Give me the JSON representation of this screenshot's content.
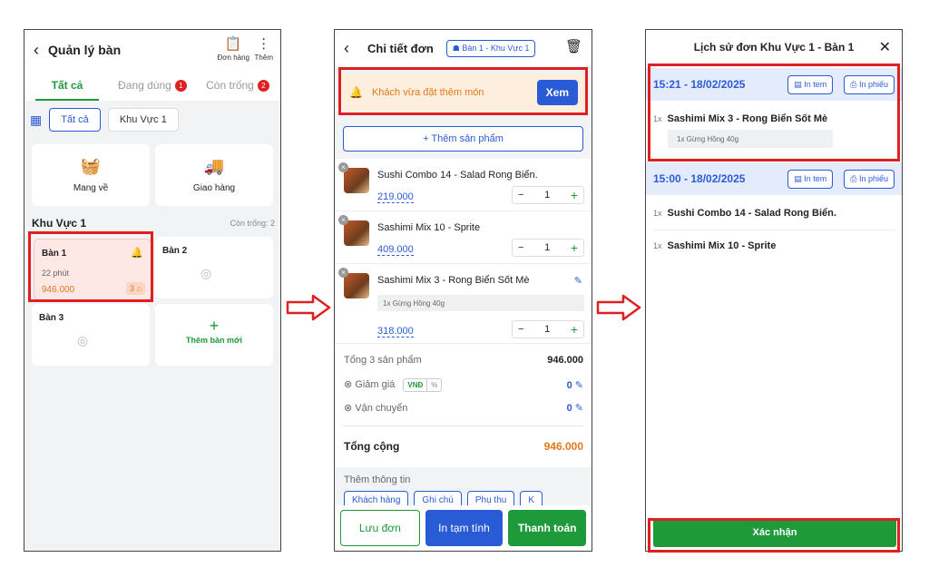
{
  "screen1": {
    "title": "Quản lý bàn",
    "tool_orders": "Đơn hàng",
    "tool_more": "Thêm",
    "tabs": [
      {
        "label": "Tất cả"
      },
      {
        "label": "Đang dùng",
        "badge": "1"
      },
      {
        "label": "Còn trống",
        "badge": "2"
      }
    ],
    "filters": [
      "Tất cả",
      "Khu Vực 1"
    ],
    "services": [
      "Mang về",
      "Giao hàng"
    ],
    "area_name": "Khu Vực 1",
    "area_free": "Còn trống: 2",
    "table1": {
      "name": "Bàn 1",
      "time": "22 phút",
      "amount": "946.000",
      "guests": "3"
    },
    "table2": {
      "name": "Bàn 2"
    },
    "table3": {
      "name": "Bàn 3"
    },
    "add_table": "Thêm bàn mới"
  },
  "screen2": {
    "title": "Chi tiết đơn",
    "table_pill": "Bàn 1 - Khu Vực 1",
    "notice_text": "Khách vừa đặt thêm món",
    "notice_button": "Xem",
    "add_product": "+ Thêm sản phẩm",
    "items": [
      {
        "name": "Sushi Combo 14 - Salad Rong Biển.",
        "price": "219.000",
        "qty": "1"
      },
      {
        "name": "Sashimi Mix 10 - Sprite",
        "price": "409.000",
        "qty": "1"
      },
      {
        "name": "Sashimi Mix 3 - Rong Biển Sốt Mè",
        "topping": "1x Gừng Hồng 40g",
        "price": "318.000",
        "qty": "1"
      }
    ],
    "subtotal_label": "Tổng 3 sản phẩm",
    "subtotal_value": "946.000",
    "discount_label": "Giảm giá",
    "discount_unit_vnd": "VNĐ",
    "discount_unit_pct": "%",
    "discount_value": "0",
    "shipping_label": "Vận chuyển",
    "shipping_value": "0",
    "total_label": "Tổng cộng",
    "total_value": "946.000",
    "more_info": "Thêm thông tin",
    "more_chips": [
      "Khách hàng",
      "Ghi chú",
      "Phụ thu",
      "K"
    ],
    "btn_save": "Lưu đơn",
    "btn_print": "In tạm tính",
    "btn_pay": "Thanh toán"
  },
  "screen3": {
    "title": "Lịch sử đơn Khu Vực 1 - Bàn 1",
    "print_label": "In tem",
    "receipt_label": "In phiếu",
    "order1": {
      "datetime": "15:21 - 18/02/2025",
      "item_qty": "1x",
      "item_name": "Sashimi Mix 3 - Rong Biển Sốt Mè",
      "topping": "1x Gừng Hồng 40g"
    },
    "order2": {
      "datetime": "15:00 - 18/02/2025",
      "items": [
        {
          "qty": "1x",
          "name": "Sushi Combo 14 - Salad Rong Biển."
        },
        {
          "qty": "1x",
          "name": "Sashimi Mix 10 - Sprite"
        }
      ]
    },
    "confirm": "Xác nhận"
  },
  "colors": {
    "accent_green": "#1e9a3a",
    "accent_blue": "#2a5bd7",
    "highlight_red": "#e02020",
    "amount_orange": "#e07a1a"
  }
}
